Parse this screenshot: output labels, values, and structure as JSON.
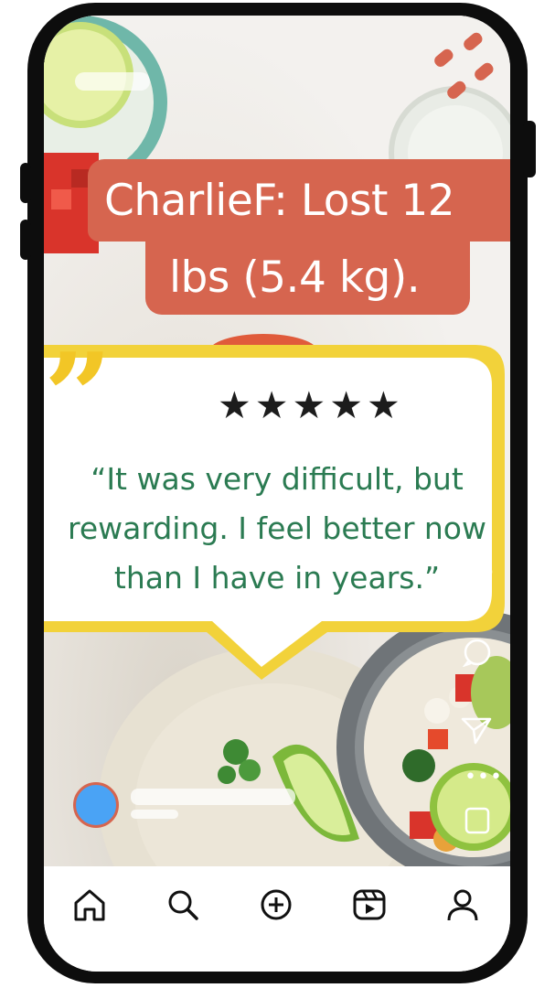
{
  "headline": {
    "line1": "CharlieF: Lost 12",
    "line2": "lbs (5.4 kg)."
  },
  "testimonial": {
    "quote_mark": "”",
    "rating": 5,
    "stars": "★★★★★",
    "text": "“It was very difficult, but rewarding. I feel better now than I have in years.”"
  },
  "colors": {
    "headline_bg": "#d6654f",
    "quote_text": "#2b7b52",
    "bubble_border": "#f2d23a",
    "quote_mark": "#f2c626",
    "avatar": "#4aa3f5"
  },
  "post_actions": [
    "heart-icon",
    "comment-icon",
    "share-icon",
    "more-icon",
    "save-icon"
  ],
  "nav": [
    "home-icon",
    "search-icon",
    "create-icon",
    "reels-icon",
    "profile-icon"
  ]
}
